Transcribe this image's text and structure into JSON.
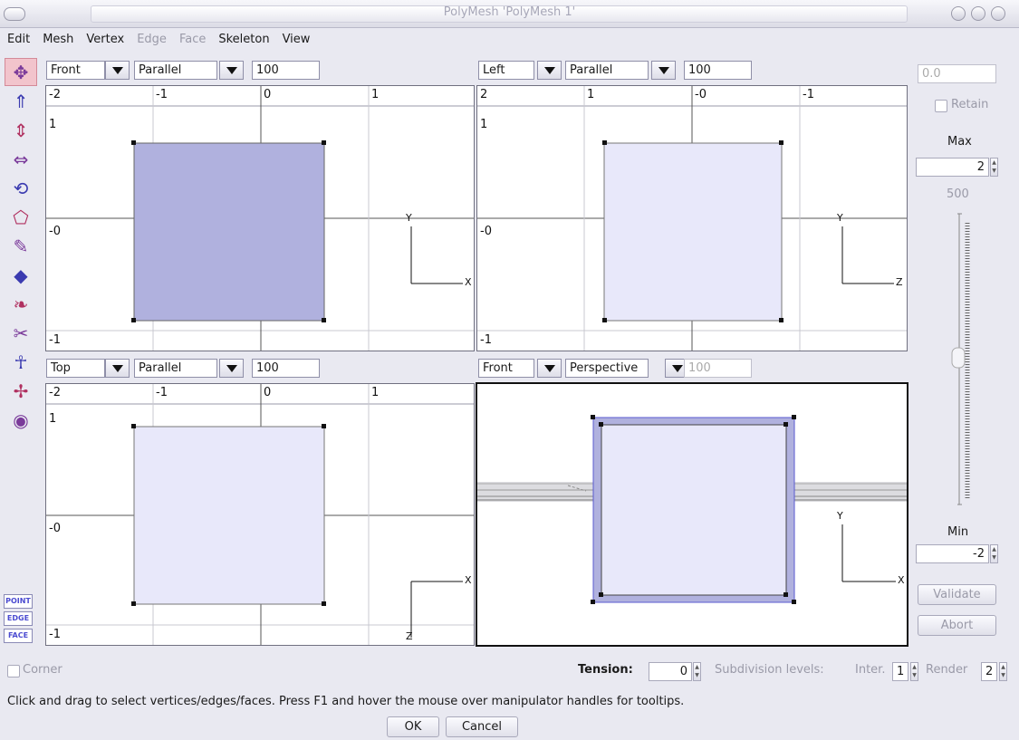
{
  "window": {
    "title": "PolyMesh 'PolyMesh 1'"
  },
  "menu": {
    "items": [
      {
        "label": "Edit",
        "enabled": true
      },
      {
        "label": "Mesh",
        "enabled": true
      },
      {
        "label": "Vertex",
        "enabled": true
      },
      {
        "label": "Edge",
        "enabled": false
      },
      {
        "label": "Face",
        "enabled": false
      },
      {
        "label": "Skeleton",
        "enabled": true
      },
      {
        "label": "View",
        "enabled": true
      }
    ]
  },
  "toolbar": {
    "tools": [
      {
        "icon": "move-tool-icon",
        "glyph": "✥",
        "active": true
      },
      {
        "icon": "scale-tool-icon",
        "glyph": "⇑"
      },
      {
        "icon": "scale-vertical-tool-icon",
        "glyph": "⇕"
      },
      {
        "icon": "scale-horizontal-tool-icon",
        "glyph": "⇔"
      },
      {
        "icon": "rotate-tool-icon",
        "glyph": "⟲"
      },
      {
        "icon": "skew-tool-icon",
        "glyph": "⬠"
      },
      {
        "icon": "bevel-tool-icon",
        "glyph": "✎"
      },
      {
        "icon": "extrude-tool-icon",
        "glyph": "◆"
      },
      {
        "icon": "smooth-brush-icon",
        "glyph": "❧"
      },
      {
        "icon": "knife-tool-icon",
        "glyph": "✂"
      },
      {
        "icon": "skeleton-tool-icon",
        "glyph": "☥"
      },
      {
        "icon": "move-view-icon",
        "glyph": "✢"
      },
      {
        "icon": "rotate-view-icon",
        "glyph": "◉"
      }
    ],
    "modes": {
      "point": "POINT",
      "edge": "EDGE",
      "face": "FACE"
    }
  },
  "viewports": {
    "top_left": {
      "view": "Front",
      "projection": "Parallel",
      "scale": "100",
      "xticks": [
        "-2",
        "-1",
        "0",
        "1"
      ],
      "ytop": "1",
      "ymid": "-0",
      "ybot": "-1",
      "axis_h": "X",
      "axis_v": "Y"
    },
    "top_right": {
      "view": "Left",
      "projection": "Parallel",
      "scale": "100",
      "xticks": [
        "2",
        "1",
        "-0",
        "-1"
      ],
      "ytop": "1",
      "ymid": "-0",
      "ybot": "-1",
      "axis_h": "Z",
      "axis_v": "Y"
    },
    "bottom_left": {
      "view": "Top",
      "projection": "Parallel",
      "scale": "100",
      "xticks": [
        "-2",
        "-1",
        "0",
        "1"
      ],
      "ytop": "1",
      "ymid": "-0",
      "ybot": "-1",
      "axis_h": "X",
      "axis_v": "Z"
    },
    "bottom_right": {
      "view": "Front",
      "projection": "Perspective",
      "scale": "100",
      "axis_h": "X",
      "axis_v": "Y"
    }
  },
  "right_panel": {
    "value": "0.0",
    "retain": "Retain",
    "max_label": "Max",
    "max_value": "2",
    "slider_top": "500",
    "min_label": "Min",
    "min_value": "-2",
    "validate": "Validate",
    "abort": "Abort"
  },
  "bottom": {
    "corner": "Corner",
    "tension_label": "Tension:",
    "tension_value": "0",
    "subdiv_label": "Subdivision levels:",
    "inter_label": "Inter.",
    "inter_value": "1",
    "render_label": "Render",
    "render_value": "2",
    "status": "Click and drag to select vertices/edges/faces. Press F1 and hover the mouse over manipulator handles for tooltips.",
    "ok": "OK",
    "cancel": "Cancel"
  },
  "colors": {
    "face_selected": "#b0b1de",
    "face_plain": "#e8e8fa",
    "accent": "#4b4bd1"
  }
}
